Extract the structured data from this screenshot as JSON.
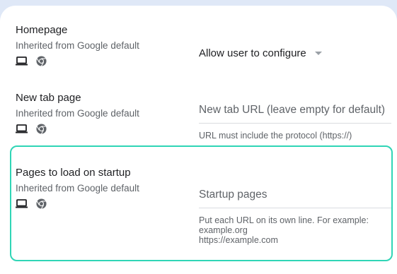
{
  "settings": {
    "homepage": {
      "title": "Homepage",
      "subtitle": "Inherited from Google default",
      "value": "Allow user to configure",
      "icons": [
        "laptop-icon",
        "chrome-icon"
      ]
    },
    "new_tab": {
      "title": "New tab page",
      "subtitle": "Inherited from Google default",
      "placeholder": "New tab URL (leave empty for default)",
      "helper": "URL must include the protocol (https://)",
      "icons": [
        "laptop-icon",
        "chrome-icon"
      ]
    },
    "startup": {
      "title": "Pages to load on startup",
      "subtitle": "Inherited from Google default",
      "placeholder": "Startup pages",
      "helper_lines": [
        "Put each URL on its own line. For example:",
        "example.org",
        "https://example.com"
      ],
      "icons": [
        "laptop-icon",
        "chrome-icon"
      ]
    }
  },
  "colors": {
    "background": "#dfe8f7",
    "card": "#ffffff",
    "highlight_border": "#30d5b6",
    "text_primary": "#202124",
    "text_secondary": "#5f6368"
  }
}
